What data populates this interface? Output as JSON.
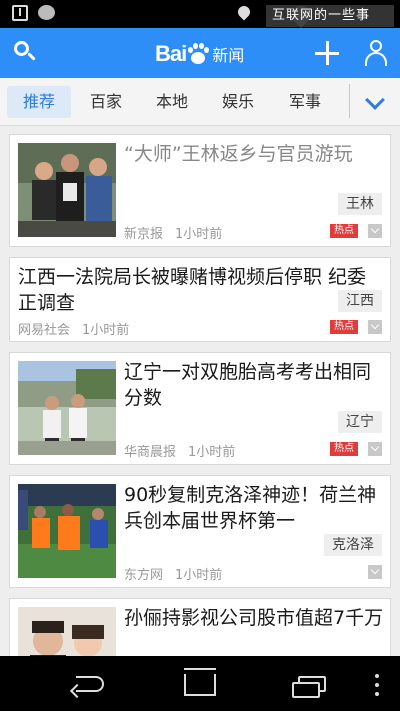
{
  "status_bar": {
    "marquee": "互联网的一些事",
    "icons": [
      "download-icon",
      "cat-icon",
      "location-icon",
      "wifi-icon"
    ]
  },
  "header": {
    "logo_left": "Bai",
    "logo_right": "新闻",
    "icons": [
      "search-icon",
      "add-icon",
      "user-icon"
    ],
    "bg_color": "#2c8ef6"
  },
  "tabs": {
    "items": [
      "推荐",
      "百家",
      "本地",
      "娱乐",
      "军事"
    ],
    "active": "推荐",
    "accent_color": "#2d7ce0"
  },
  "feed": [
    {
      "title": "“大师”王林返乡与官员游玩",
      "read": true,
      "tag": "王林",
      "source": "新京报",
      "time": "1小时前",
      "hot_label": "热点"
    },
    {
      "title": "江西一法院局长被曝赌博视频后停职 纪委正调查",
      "read": false,
      "tag": "江西",
      "source": "网易社会",
      "time": "1小时前",
      "hot_label": "热点"
    },
    {
      "title": "辽宁一对双胞胎高考考出相同分数",
      "read": false,
      "tag": "辽宁",
      "source": "华商晨报",
      "time": "1小时前",
      "hot_label": "热点"
    },
    {
      "title": "90秒复制克洛泽神迹！荷兰神兵创本届世界杯第一",
      "read": false,
      "tag": "克洛泽",
      "source": "东方网",
      "time": "1小时前"
    },
    {
      "title": "孙俪持影视公司股市值超7千万",
      "read": false
    }
  ],
  "nav_bar": {
    "icons": [
      "back-icon",
      "home-icon",
      "recent-apps-icon",
      "menu-icon"
    ]
  }
}
